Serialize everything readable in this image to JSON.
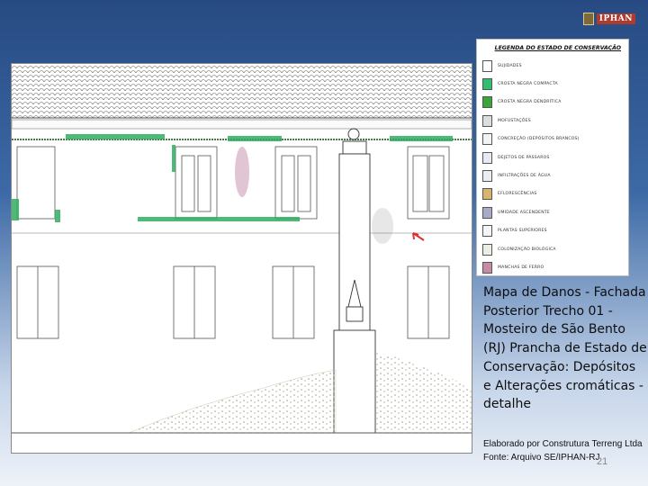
{
  "logo": {
    "text": "IPHAN"
  },
  "legend": {
    "title": "LEGENDA DO ESTADO DE CONSERVAÇÃO",
    "items": [
      {
        "label": "SUJIDADES",
        "color": "#ffffff",
        "icon": "dots-swatch"
      },
      {
        "label": "CROSTA NEGRA COMPACTA",
        "color": "#2fbf6e",
        "icon": "green-blob-swatch"
      },
      {
        "label": "CROSTA NEGRA DENDRÍTICA",
        "color": "#3aa53a",
        "icon": "green-dendritic-swatch"
      },
      {
        "label": "MOFUSTAÇÕES",
        "color": "#dddddd",
        "icon": "gray-swatch"
      },
      {
        "label": "CONCREÇÃO (DEPÓSITOS BRANCOS)",
        "color": "#f3f3f3",
        "icon": "hatched-swatch"
      },
      {
        "label": "DEJETOS DE PÁSSAROS",
        "color": "#e9e9f6",
        "icon": "light-swatch"
      },
      {
        "label": "INFILTRAÇÕES DE ÁGUA",
        "color": "#ececf3",
        "icon": "lined-swatch"
      },
      {
        "label": "EFLORESCÊNCIAS",
        "color": "#d9b46e",
        "icon": "orange-dots-swatch"
      },
      {
        "label": "UMIDADE ASCENDENTE",
        "color": "#a9a9c9",
        "icon": "blue-lines-swatch"
      },
      {
        "label": "PLANTAS SUPERIORES",
        "color": "#f5f5f5",
        "icon": "plant-swatch"
      },
      {
        "label": "COLONIZAÇÃO BIOLÓGICA",
        "color": "#e9f0e2",
        "icon": "bio-swatch"
      },
      {
        "label": "MANCHAS DE FERRO",
        "color": "#c98aa5",
        "icon": "pink-swatch"
      }
    ]
  },
  "caption": {
    "text": "Mapa de Danos - Fachada Posterior Trecho 01 - Mosteiro de São Bento (RJ) Prancha de Estado de Conservação: Depósitos e Alterações cromáticas - detalhe"
  },
  "credits": {
    "text": "Elaborado por Construtura Terreng Ltda Fonte: Arquivo SE/IPHAN-RJ"
  },
  "page_number": "21"
}
